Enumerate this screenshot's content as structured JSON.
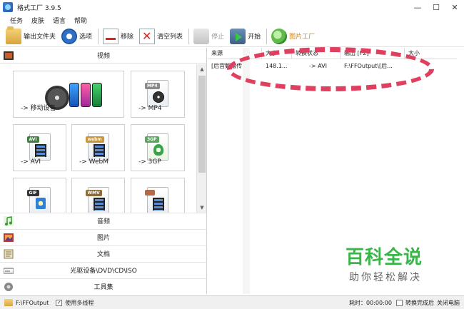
{
  "window": {
    "title": "格式工厂 3.9.5",
    "buttons": [
      "—",
      "☐",
      "✕"
    ]
  },
  "menu": [
    "任务",
    "皮肤",
    "语言",
    "帮助"
  ],
  "toolbar": {
    "output_folder": "输出文件夹",
    "options": "选项",
    "remove": "移除",
    "clear_list": "清空列表",
    "stop": "停止",
    "start": "开始",
    "picture_factory": "图片工厂"
  },
  "video_panel": {
    "title": "视频",
    "tiles": [
      {
        "label": "-> 移动设备",
        "icon": "mobile-devices-icon"
      },
      {
        "label": "-> MP4",
        "badge": "MP4",
        "icon": "mp4-file-icon"
      },
      {
        "label": "-> AVI",
        "badge": "AVI",
        "icon": "avi-file-icon"
      },
      {
        "label": "-> WebM",
        "badge": "webm",
        "icon": "webm-file-icon"
      },
      {
        "label": "-> 3GP",
        "badge": "3GP",
        "icon": "3gp-file-icon"
      },
      {
        "label": "",
        "badge": "GIF",
        "icon": "gif-file-icon"
      },
      {
        "label": "",
        "badge": "WMV",
        "icon": "wmv-file-icon"
      },
      {
        "label": "",
        "badge": "",
        "icon": "video-file-icon"
      }
    ]
  },
  "categories": [
    {
      "label": "音频",
      "icon": "music-note-icon"
    },
    {
      "label": "图片",
      "icon": "picture-icon"
    },
    {
      "label": "文档",
      "icon": "document-icon"
    },
    {
      "label": "光驱设备\\DVD\\CD\\ISO",
      "icon": "optical-drive-icon"
    },
    {
      "label": "工具集",
      "icon": "toolbox-icon"
    }
  ],
  "task_table": {
    "headers": [
      "来源",
      "大小",
      "转换状态",
      "输出 [F2]",
      "大小"
    ],
    "rows": [
      {
        "source": "[后宫甄嬛传]...",
        "size": "148.1...",
        "status": "-> AVI",
        "output": "F:\\FFOutput\\[后...",
        "out_size": ""
      }
    ]
  },
  "status_bar": {
    "output_path": "F:\\FFOutput",
    "multithread": "使用多线程",
    "elapsed_label": "耗时：00:00:00",
    "after_done": "转换完成后",
    "shutdown": "关闭电脑"
  },
  "watermark": {
    "big": "百科全说",
    "small": "助你轻松解决"
  },
  "colors": {
    "highlight": "#e0405f",
    "watermark_green": "#39b54a"
  }
}
